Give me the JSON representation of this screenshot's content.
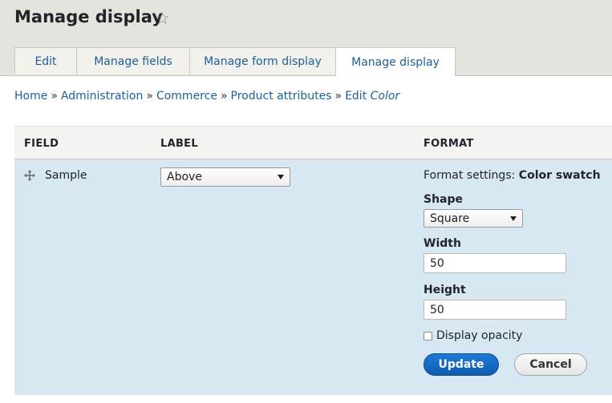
{
  "header": {
    "title": "Manage display",
    "star_icon": "star-outline-icon"
  },
  "tabs": [
    {
      "label": "Edit",
      "active": false
    },
    {
      "label": "Manage fields",
      "active": false
    },
    {
      "label": "Manage form display",
      "active": false
    },
    {
      "label": "Manage display",
      "active": true
    }
  ],
  "breadcrumb": {
    "items": [
      "Home",
      "Administration",
      "Commerce",
      "Product attributes"
    ],
    "separator": "»",
    "edit_prefix": "Edit",
    "edit_item": "Color"
  },
  "table": {
    "headers": {
      "field": "FIELD",
      "label": "LABEL",
      "format": "FORMAT"
    },
    "row": {
      "drag_icon": "drag-handle-icon",
      "field": "Sample",
      "label_select": "Above",
      "format_summary_prefix": "Format settings:",
      "format_summary_value": "Color swatch",
      "shape_label": "Shape",
      "shape_value": "Square",
      "width_label": "Width",
      "width_value": "50",
      "height_label": "Height",
      "height_value": "50",
      "opacity_label": "Display opacity",
      "opacity_checked": false,
      "update_button": "Update",
      "cancel_button": "Cancel"
    }
  },
  "colors": {
    "header_bg": "#e4e3dd",
    "link": "#1c5f99",
    "row_bg": "#d8e8f3",
    "primary_button": "#1e7ad6"
  }
}
